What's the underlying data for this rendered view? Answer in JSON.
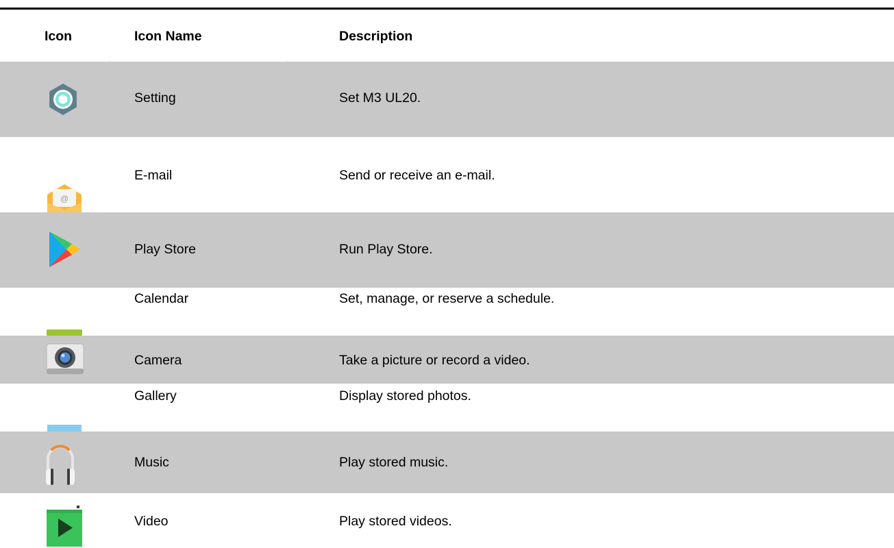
{
  "table": {
    "headers": {
      "icon": "Icon",
      "name": "Icon Name",
      "description": "Description"
    },
    "rows": [
      {
        "icon": "settings-gear-icon",
        "name": "Setting",
        "description": "Set M3 UL20."
      },
      {
        "icon": "email-envelope-icon",
        "name": "E-mail",
        "description": "Send or receive an e-mail."
      },
      {
        "icon": "play-store-icon",
        "name": "Play Store",
        "description": "Run Play Store."
      },
      {
        "icon": "calendar-icon",
        "name": "Calendar",
        "description": "Set, manage, or reserve a schedule."
      },
      {
        "icon": "camera-icon",
        "name": "Camera",
        "description": "Take a picture or record a video."
      },
      {
        "icon": "gallery-icon",
        "name": "Gallery",
        "description": "Display stored photos."
      },
      {
        "icon": "headphones-icon",
        "name": "Music",
        "description": "Play stored music."
      },
      {
        "icon": "video-play-icon",
        "name": "Video",
        "description": "Play stored videos."
      }
    ]
  },
  "colors": {
    "shaded_row": "#c8c8c8",
    "rule": "#000000",
    "text": "#000000"
  }
}
